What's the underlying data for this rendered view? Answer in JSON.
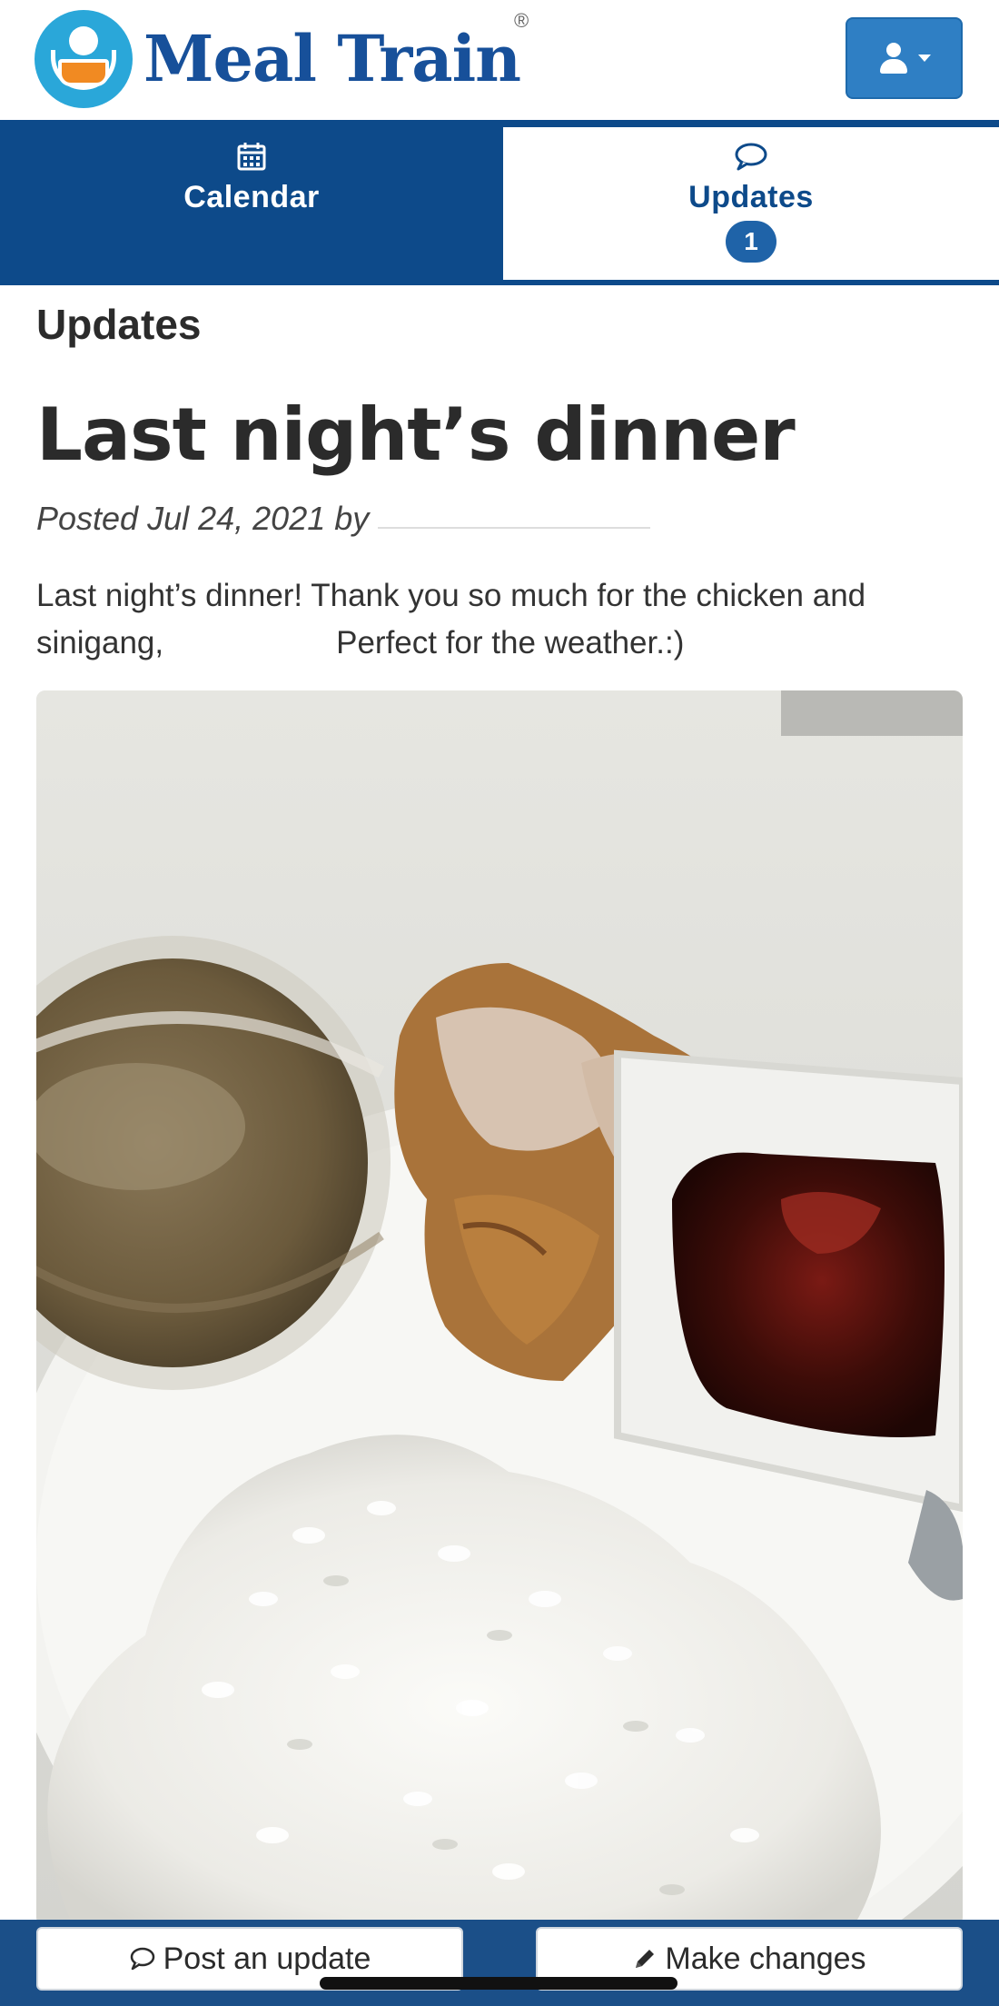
{
  "header": {
    "logo_text": "Meal Train",
    "logo_reg": "®",
    "account_icon": "user-icon",
    "account_caret_icon": "caret-down-icon"
  },
  "tabs": [
    {
      "label": "Calendar",
      "icon": "calendar-icon",
      "active": false
    },
    {
      "label": "Updates",
      "icon": "chat-bubble-icon",
      "active": true,
      "badge": "1"
    }
  ],
  "main": {
    "section_title": "Updates",
    "post": {
      "title": "Last night’s dinner",
      "meta": "Posted Jul 24, 2021 by",
      "body_line1": "Last night’s dinner! Thank you so much for the chicken and",
      "body_line2_start": "sinigang,",
      "body_line2_end": "Perfect for the weather.:)"
    }
  },
  "bottom_bar": {
    "post_update_label": "Post an update",
    "post_update_icon": "chat-bubble-icon",
    "make_changes_label": "Make changes",
    "make_changes_icon": "pencil-icon"
  },
  "colors": {
    "brand_blue": "#0d4a8a",
    "logo_blue": "#17509a",
    "logo_teal": "#2aa7d9",
    "button_blue": "#2f7fc4"
  }
}
